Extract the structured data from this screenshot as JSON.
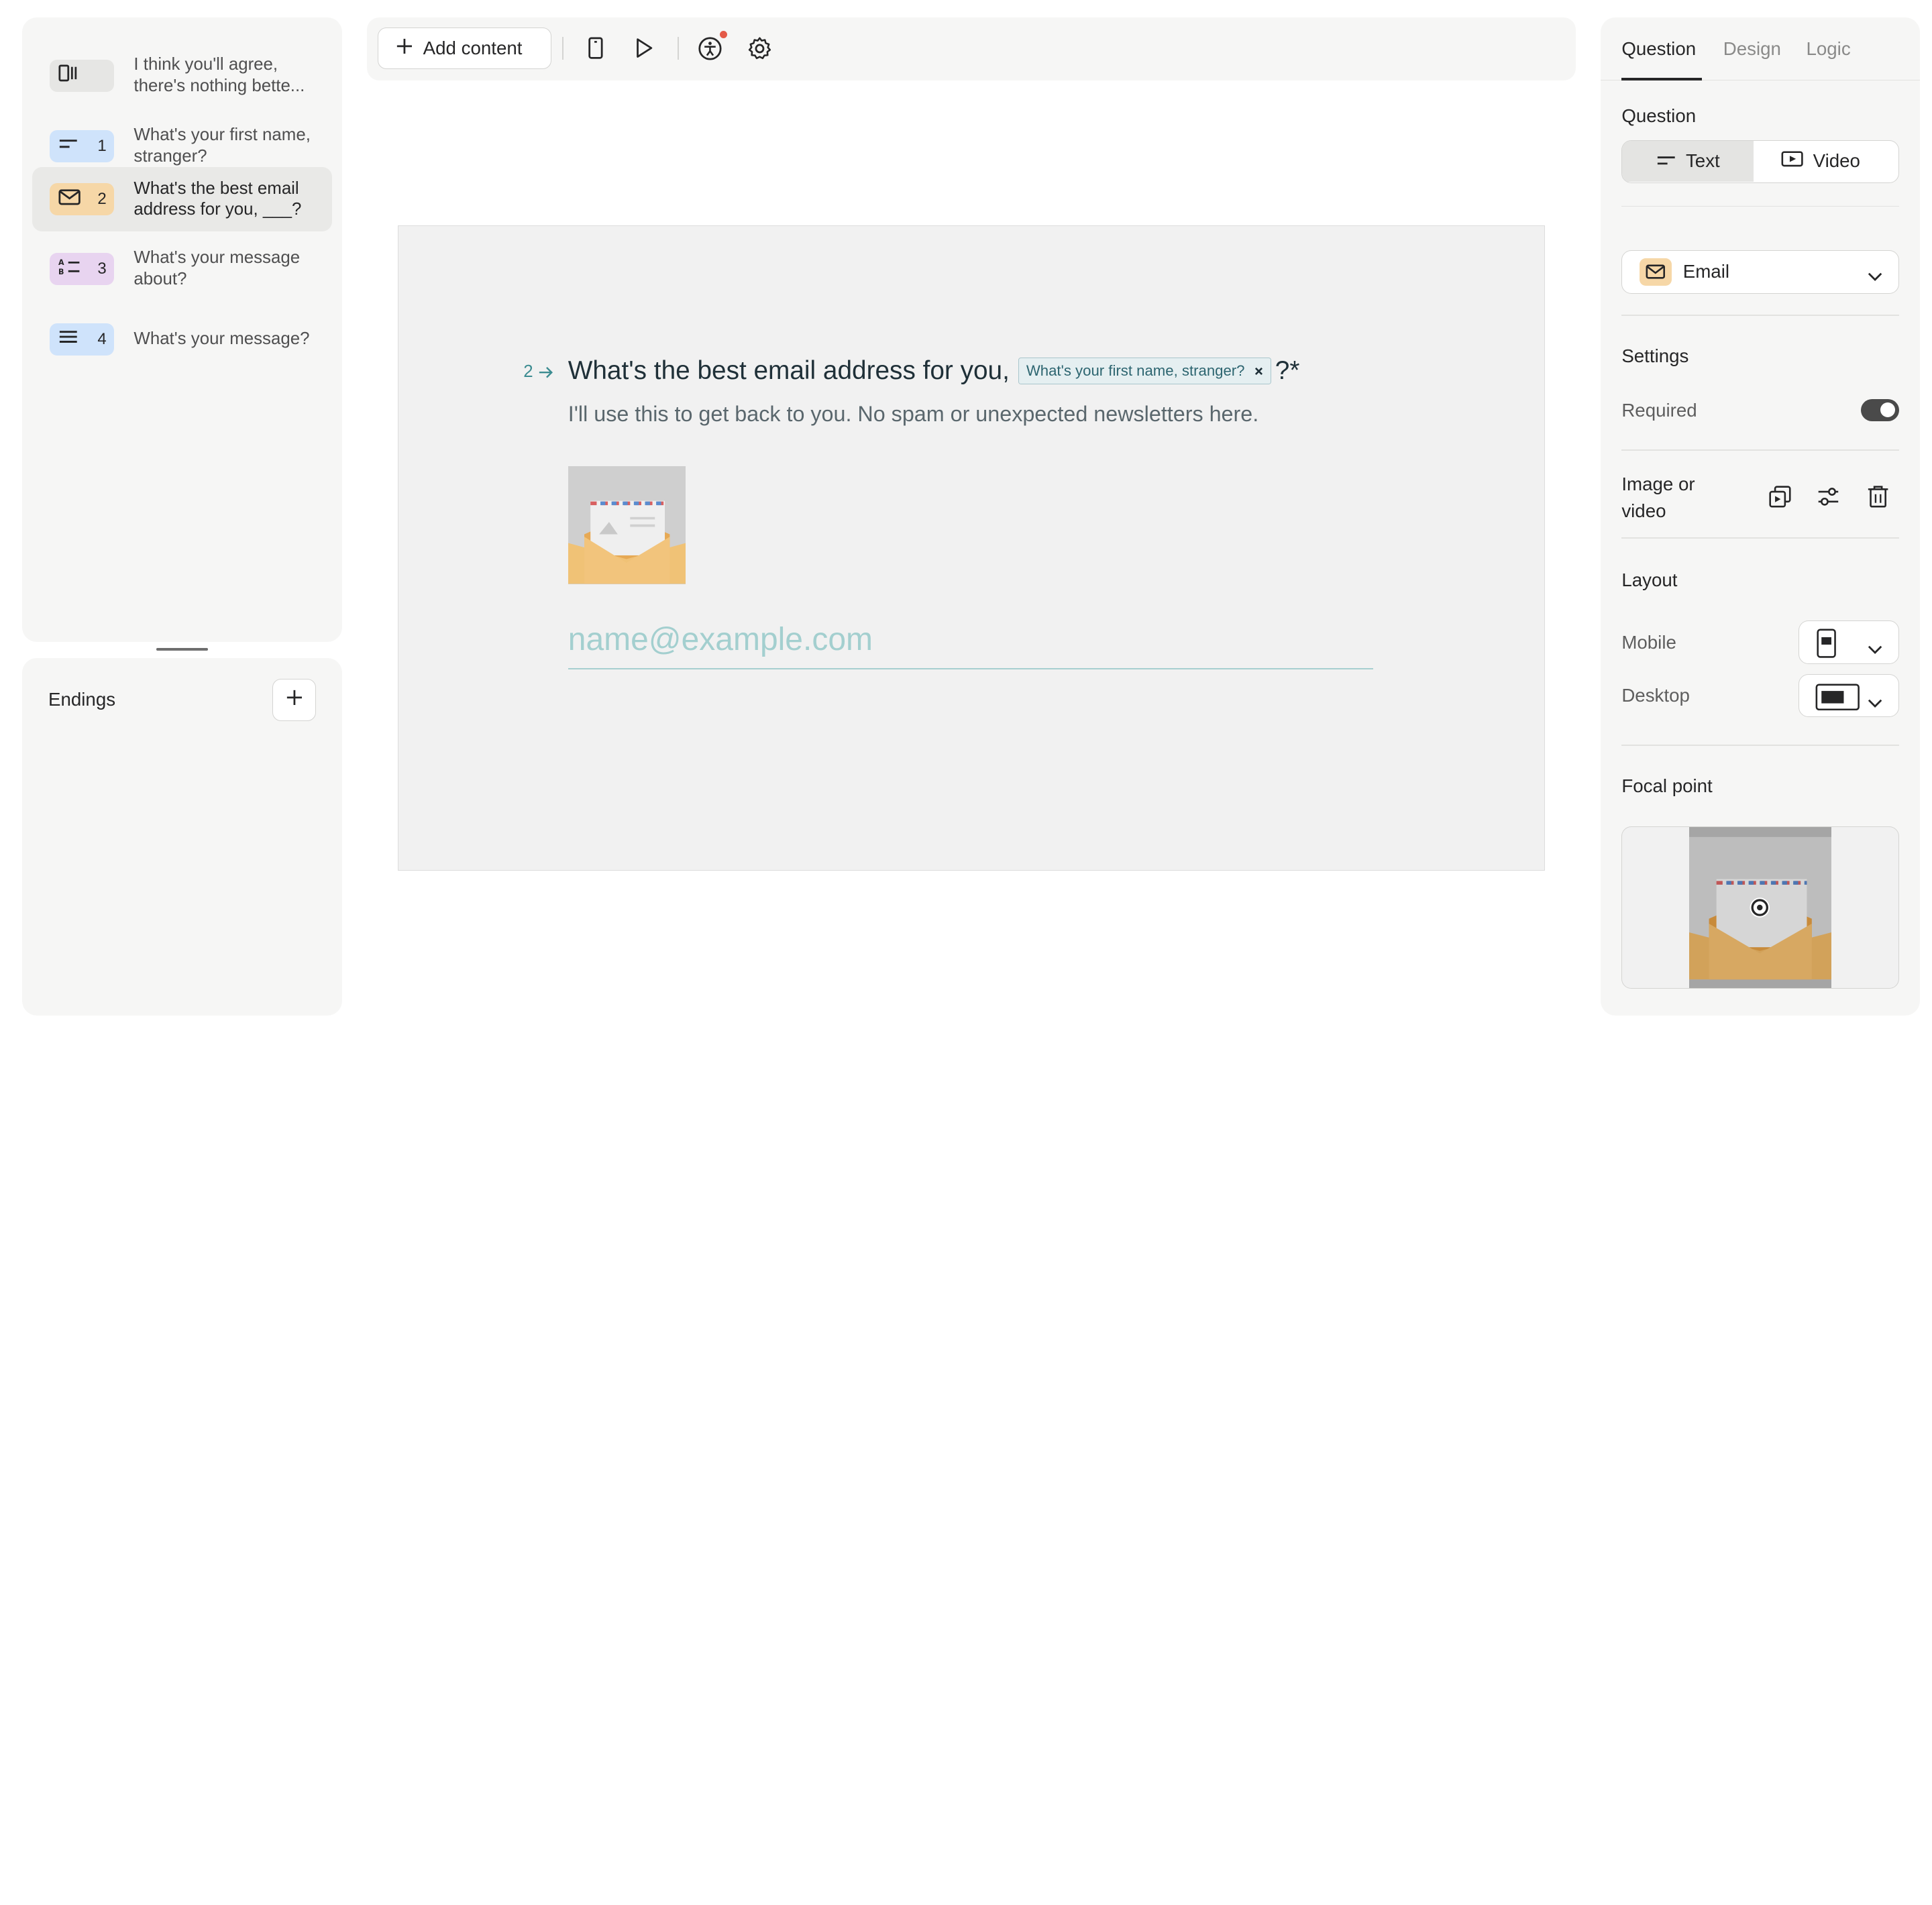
{
  "sidebar": {
    "questions": [
      {
        "number": "",
        "text": "I think you'll agree, there's nothing bette...",
        "badge_color": "#e6e6e4",
        "icon": "statement-icon"
      },
      {
        "number": "1",
        "text": "What's your first name, stranger?",
        "badge_color": "#cfe3fb",
        "icon": "short-text-icon"
      },
      {
        "number": "2",
        "text": "What's the best email address for you, ___?",
        "badge_color": "#f6d7a7",
        "icon": "mail-icon"
      },
      {
        "number": "3",
        "text": "What's your message about?",
        "badge_color": "#e8d4f0",
        "icon": "multiple-choice-icon"
      },
      {
        "number": "4",
        "text": "What's your message?",
        "badge_color": "#cfe3fb",
        "icon": "long-text-icon"
      }
    ],
    "endings_label": "Endings"
  },
  "toolbar": {
    "add_content_label": "Add content"
  },
  "canvas": {
    "question_number": "2",
    "question_title": "What's the best email address for you,",
    "recall_chip": "What's your first name, stranger?",
    "title_suffix": "?*",
    "subtitle": "I'll use this to get back to you. No spam or unexpected newsletters here.",
    "email_placeholder": "name@example.com"
  },
  "right_panel": {
    "tabs": [
      "Question",
      "Design",
      "Logic"
    ],
    "active_tab": "Question",
    "question_label": "Question",
    "question_type_options": [
      "Text",
      "Video"
    ],
    "question_type_selected": "Text",
    "question_kind": "Email",
    "settings_label": "Settings",
    "required_label": "Required",
    "required_on": true,
    "media_label": "Image or video",
    "layout_label": "Layout",
    "mobile_label": "Mobile",
    "desktop_label": "Desktop",
    "focal_point_label": "Focal point"
  },
  "colors": {
    "accent": "#3c8c91",
    "email_badge": "#f6d7a7",
    "notification_dot": "#e45a48"
  }
}
